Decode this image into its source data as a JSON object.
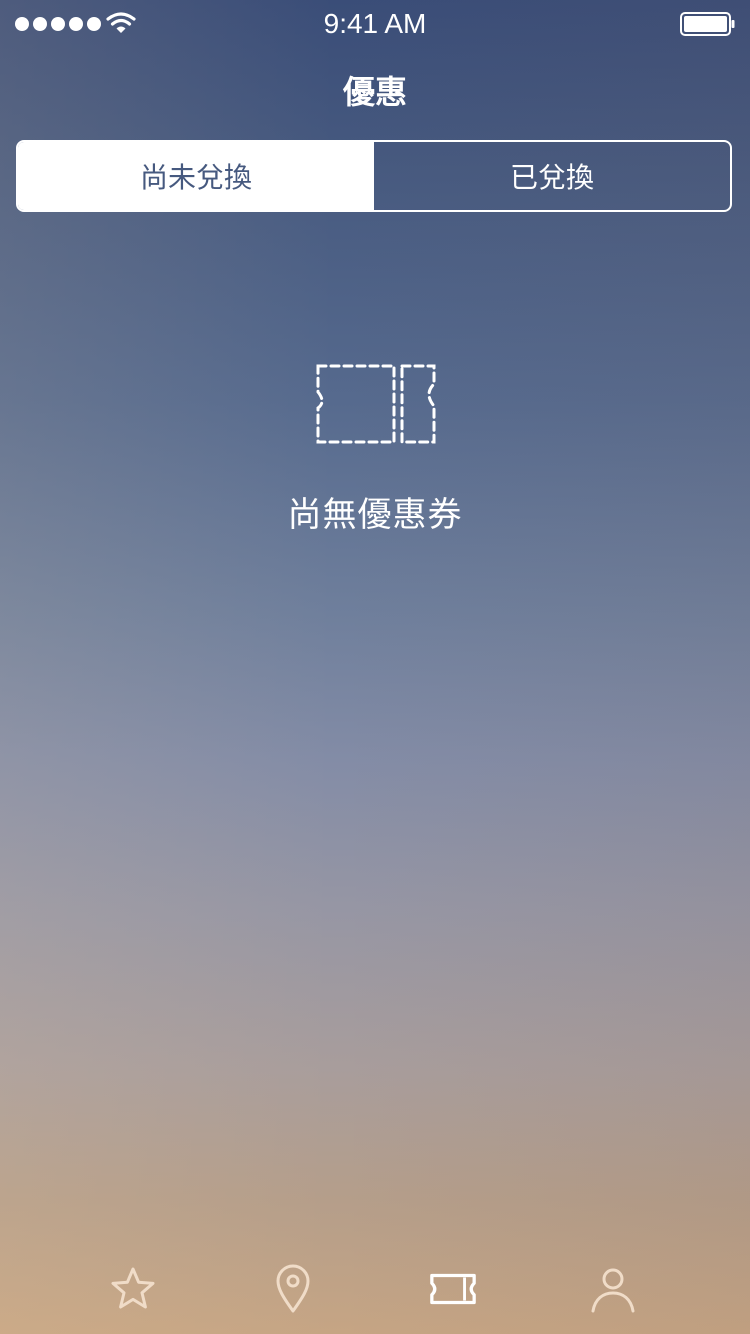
{
  "status_bar": {
    "time": "9:41 AM",
    "signal_icon": "signal-dots-icon",
    "wifi_icon": "wifi-icon",
    "battery_icon": "battery-icon"
  },
  "header": {
    "title": "優惠"
  },
  "segment": {
    "tabs": [
      {
        "label": "尚未兌換",
        "active": true
      },
      {
        "label": "已兌換",
        "active": false
      }
    ]
  },
  "empty_state": {
    "icon": "coupon-outline-icon",
    "message": "尚無優惠券"
  },
  "tabbar": {
    "items": [
      {
        "icon": "star-icon",
        "active": false
      },
      {
        "icon": "location-pin-icon",
        "active": false
      },
      {
        "icon": "ticket-icon",
        "active": true
      },
      {
        "icon": "user-icon",
        "active": false
      }
    ]
  },
  "colors": {
    "accent_text": "#46597f",
    "foreground": "#ffffff",
    "inactive_tab_icon": "#f0dcc8"
  }
}
